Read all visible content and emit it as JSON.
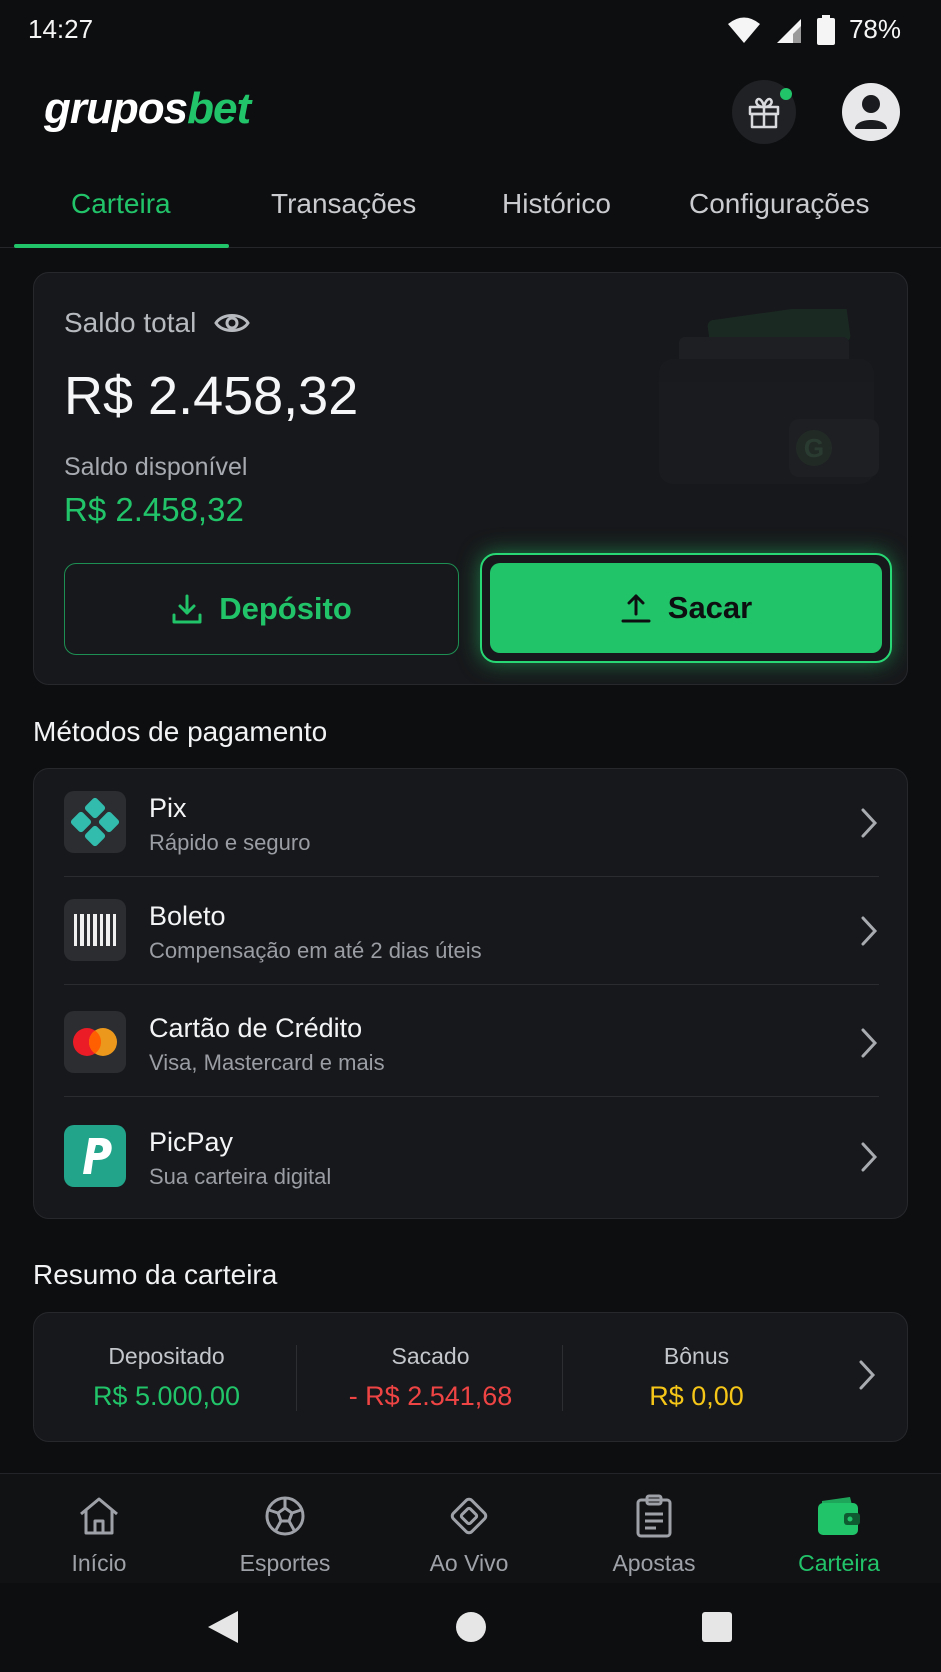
{
  "status_bar": {
    "time": "14:27",
    "battery": "78%"
  },
  "header": {
    "logo_part1": "grupos",
    "logo_part2": "bet",
    "gift_icon": "gift-icon",
    "profile_icon": "user-avatar-icon",
    "accent_color": "#22c46a"
  },
  "tabs": [
    {
      "label": "Carteira",
      "active": true
    },
    {
      "label": "Transações",
      "active": false
    },
    {
      "label": "Histórico",
      "active": false
    },
    {
      "label": "Configurações",
      "active": false
    }
  ],
  "balance": {
    "total_label": "Saldo total",
    "total_value": "R$ 2.458,32",
    "available_label": "Saldo disponível",
    "available_value": "R$ 2.458,32",
    "deposit_label": "Depósito",
    "withdraw_label": "Sacar"
  },
  "payment_methods": {
    "title": "Métodos de pagamento",
    "items": [
      {
        "name": "Pix",
        "subtitle": "Rápido e seguro",
        "icon": "pix-icon"
      },
      {
        "name": "Boleto",
        "subtitle": "Compensação em até 2 dias úteis",
        "icon": "barcode-icon"
      },
      {
        "name": "Cartão de Crédito",
        "subtitle": "Visa, Mastercard e mais",
        "icon": "mastercard-icon"
      },
      {
        "name": "PicPay",
        "subtitle": "Sua carteira digital",
        "icon": "picpay-icon"
      }
    ]
  },
  "summary": {
    "title": "Resumo da carteira",
    "deposited_label": "Depositado",
    "deposited_value": "R$ 5.000,00",
    "withdrawn_label": "Sacado",
    "withdrawn_value": "- R$ 2.541,68",
    "bonus_label": "Bônus",
    "bonus_value": "R$ 0,00",
    "colors": {
      "deposited": "#22c46a",
      "withdrawn": "#ef4444",
      "bonus": "#f5c518"
    }
  },
  "bottom_nav": [
    {
      "label": "Início",
      "icon": "home-icon",
      "active": false
    },
    {
      "label": "Esportes",
      "icon": "soccer-ball-icon",
      "active": false
    },
    {
      "label": "Ao Vivo",
      "icon": "live-icon",
      "active": false
    },
    {
      "label": "Apostas",
      "icon": "clipboard-icon",
      "active": false
    },
    {
      "label": "Carteira",
      "icon": "wallet-icon",
      "active": true
    }
  ]
}
